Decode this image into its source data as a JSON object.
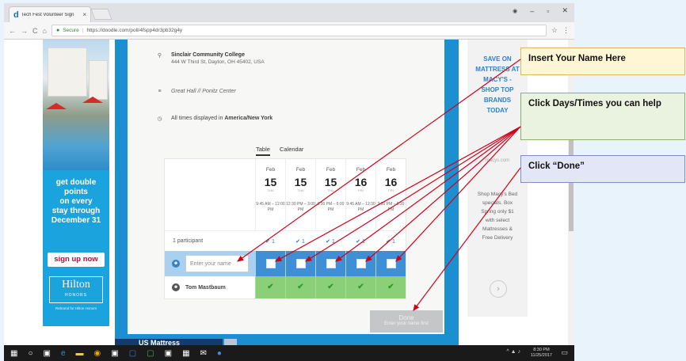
{
  "browser": {
    "tab_title": "Tech Fest Volunteer Sign",
    "tab_favicon": "d",
    "tab_close": "×",
    "url_secure": "Secure",
    "url": "https://doodle.com/poll/4fspp4dr3pb32g4y",
    "window_user_icon": "user-icon",
    "minimize": "–",
    "maximize": "▫",
    "close": "✕",
    "nav_back": "←",
    "nav_forward": "→",
    "nav_reload": "C",
    "nav_home": "⌂",
    "star": "☆",
    "menu": "⋮"
  },
  "ad_left": {
    "headline_lines": [
      "get double",
      "points",
      "on every",
      "stay through",
      "December 31"
    ],
    "button": "sign up now",
    "brand": "Hilton",
    "brand_sub": "HONORS",
    "note": "Rebrand for Hilton Honors"
  },
  "event": {
    "location_name": "Sinclair Community College",
    "location_address": "444 W Third St, Dayton, OH 45402, USA",
    "room": "Great Hall // Ponitz Center",
    "timezone_prefix": "All times displayed in",
    "timezone": "America/New York"
  },
  "view_tabs": {
    "table": "Table",
    "calendar": "Calendar"
  },
  "poll": {
    "columns": [
      {
        "month": "Feb",
        "day": "15",
        "dow": "THU",
        "time": "9:45 AM – 12:00 PM"
      },
      {
        "month": "Feb",
        "day": "15",
        "dow": "THU",
        "time": "12:30 PM – 3:00 PM"
      },
      {
        "month": "Feb",
        "day": "15",
        "dow": "THU",
        "time": "3:00 PM – 6:00 PM"
      },
      {
        "month": "Feb",
        "day": "16",
        "dow": "FRI",
        "time": "9:45 AM – 12:30 PM"
      },
      {
        "month": "Feb",
        "day": "16",
        "dow": "FRI",
        "time": "2:30 PM – 5:30 PM"
      }
    ],
    "participants_label": "1 participant",
    "participant_counts": [
      "1",
      "1",
      "1",
      "1",
      "1"
    ],
    "name_placeholder": "Enter your name",
    "existing_participant": "Tom Mastbaum",
    "check": "✔"
  },
  "done_button": {
    "label": "Done",
    "sub": "Enter your name first"
  },
  "ad_right": {
    "lines": [
      "SAVE ON",
      "MATTRESS AT",
      "MACY'S -",
      "SHOP TOP",
      "BRANDS",
      "TODAY"
    ],
    "url": "macys.com",
    "body_lines": [
      "Shop Macy's Bed",
      "specials. Box",
      "Spring only $1",
      "with select",
      "Mattresses &",
      "Free Delivery"
    ],
    "arrow": "›"
  },
  "bottom_banner": "US Mattress",
  "taskbar": {
    "time": "8:30 PM",
    "date": "11/25/2017"
  },
  "callouts": {
    "name": "Insert Your Name Here",
    "days": "Click Days/Times you can help",
    "done": "Click “Done”"
  }
}
